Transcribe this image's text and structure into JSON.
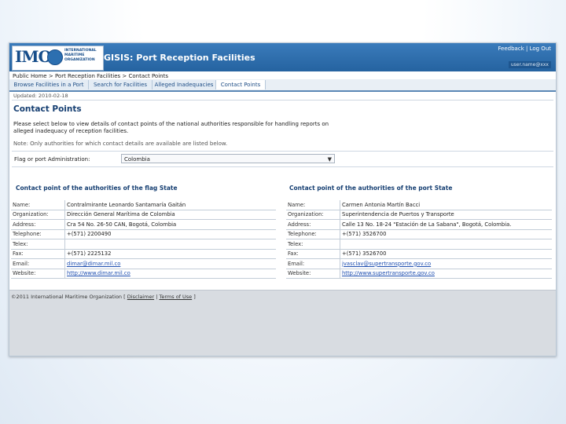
{
  "header": {
    "logo_text": "IMO",
    "logo_subtext": "INTERNATIONAL MARITIME ORGANIZATION",
    "app_title": "GISIS: Port Reception Facilities",
    "feedback_label": "Feedback",
    "separator": "|",
    "logout_label": "Log Out",
    "user_label": "user.name@xxx"
  },
  "breadcrumb": {
    "public_home": "Public Home",
    "sep1": " > ",
    "port_reception": "Port Reception Facilities",
    "sep2": " > ",
    "current": "Contact Points"
  },
  "tabs": [
    {
      "label": "Browse Facilities in a Port"
    },
    {
      "label": "Search for Facilities"
    },
    {
      "label": "Alleged Inadequacies"
    },
    {
      "label": "Contact Points"
    }
  ],
  "main": {
    "updated": "Updated: 2010-02-18",
    "title": "Contact Points",
    "intro": "Please select below to view details of contact points of the national authorities responsible for handling reports on alleged inadequacy of reception facilities.",
    "note": "Note: Only authorities for which contact details are available are listed below.",
    "flag_label": "Flag or port Administration:",
    "flag_value": "Colombia"
  },
  "flag_contact": {
    "title": "Contact point of the authorities of the flag State",
    "rows": [
      {
        "key": "Name:",
        "value": "Contralmirante Leonardo Santamaría Gaitán"
      },
      {
        "key": "Organization:",
        "value": "Dirección General Marítima de Colombia"
      },
      {
        "key": "Address:",
        "value": "Cra 54 No. 26-50 CAN, Bogotá, Colombia"
      },
      {
        "key": "Telephone:",
        "value": "+(571) 2200490"
      },
      {
        "key": "Telex:",
        "value": ""
      },
      {
        "key": "Fax:",
        "value": "+(571) 2225132"
      },
      {
        "key": "Email:",
        "value": "dimar@dimar.mil.co"
      },
      {
        "key": "Website:",
        "value": "http://www.dimar.mil.co"
      }
    ]
  },
  "port_contact": {
    "title": "Contact point of the authorities of the port State",
    "rows": [
      {
        "key": "Name:",
        "value": "Carmen Antonia Martín Bacci"
      },
      {
        "key": "Organization:",
        "value": "Superintendencia de Puertos y Transporte"
      },
      {
        "key": "Address:",
        "value": "Calle 13 No. 18-24 \"Estación de La Sabana\", Bogotá, Colombia."
      },
      {
        "key": "Telephone:",
        "value": "+(571) 3526700"
      },
      {
        "key": "Telex:",
        "value": ""
      },
      {
        "key": "Fax:",
        "value": "+(571) 3526700"
      },
      {
        "key": "Email:",
        "value": "jvasclav@supertransporte.gov.co"
      },
      {
        "key": "Website:",
        "value": "http://www.supertransporte.gov.co"
      }
    ]
  },
  "footer": {
    "copyright": "©2011 International Maritime Organization",
    "disclaimer": "Disclaimer",
    "terms": "Terms of Use"
  }
}
